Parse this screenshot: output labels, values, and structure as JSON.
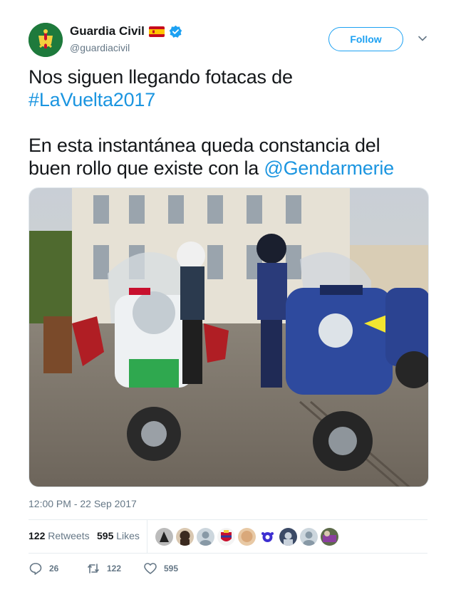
{
  "author": {
    "name": "Guardia Civil",
    "handle": "@guardiacivil",
    "flag_icon": "spain-flag-icon",
    "verified_icon": "verified-badge-icon",
    "avatar_color": "#1e7a3c"
  },
  "follow_label": "Follow",
  "tweet": {
    "line1": "Nos siguen llegando fotacas de",
    "hashtag": "#LaVuelta2017",
    "line3": "En esta instantánea queda constancia del",
    "line4_text": "buen rollo que existe con la ",
    "mention": "@Gendarmerie"
  },
  "photo": {
    "icon": "motorcycle-photo"
  },
  "timestamp": "12:00 PM - 22 Sep 2017",
  "stats": {
    "retweets_count": "122",
    "retweets_label": "Retweets",
    "likes_count": "595",
    "likes_label": "Likes"
  },
  "actions": {
    "reply_count": "26",
    "retweet_count": "122",
    "like_count": "595"
  },
  "colors": {
    "link": "#1b95e0",
    "follow": "#1da1f2",
    "muted": "#657786"
  }
}
